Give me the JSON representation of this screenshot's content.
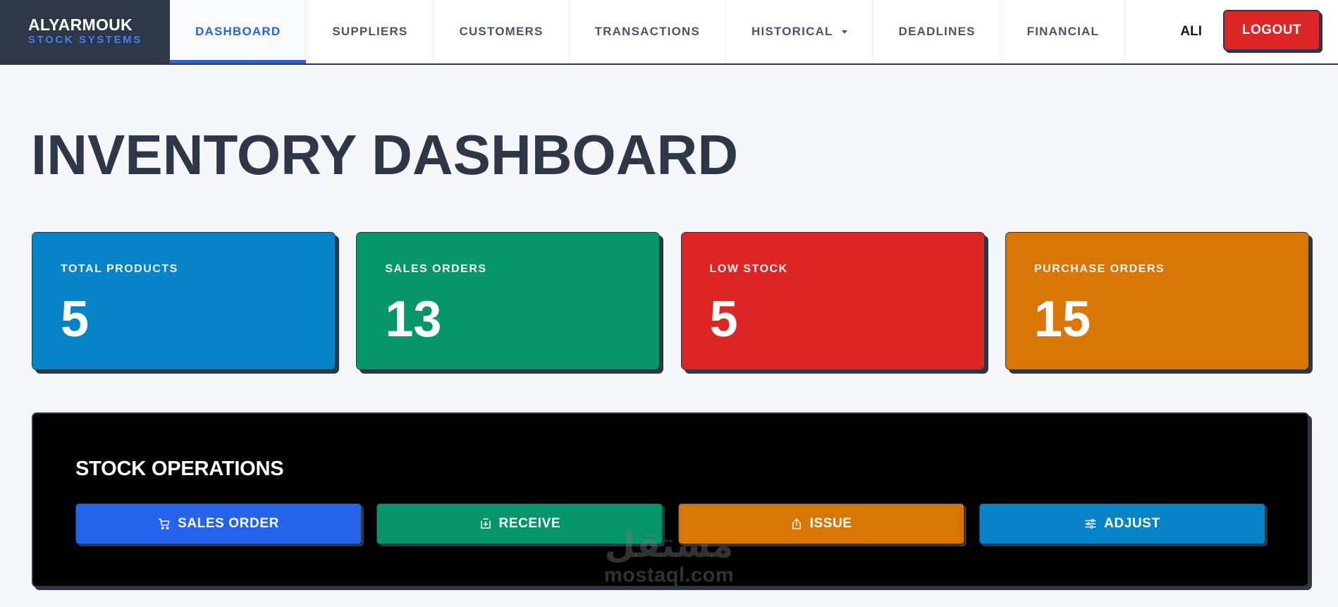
{
  "brand": {
    "name": "ALYARMOUK",
    "subtitle": "STOCK SYSTEMS"
  },
  "nav": {
    "items": [
      {
        "label": "DASHBOARD",
        "active": true
      },
      {
        "label": "SUPPLIERS"
      },
      {
        "label": "CUSTOMERS"
      },
      {
        "label": "TRANSACTIONS"
      },
      {
        "label": "HISTORICAL",
        "has_dropdown": true
      },
      {
        "label": "DEADLINES"
      },
      {
        "label": "FINANCIAL"
      }
    ]
  },
  "user": {
    "name": "ALI",
    "logout_label": "LOGOUT"
  },
  "page": {
    "title": "INVENTORY DASHBOARD"
  },
  "stats": [
    {
      "label": "TOTAL PRODUCTS",
      "value": "5",
      "color": "#0784c7"
    },
    {
      "label": "SALES ORDERS",
      "value": "13",
      "color": "#079669"
    },
    {
      "label": "LOW STOCK",
      "value": "5",
      "color": "#dc2626"
    },
    {
      "label": "PURCHASE ORDERS",
      "value": "15",
      "color": "#d97706"
    }
  ],
  "operations": {
    "title": "STOCK OPERATIONS",
    "buttons": [
      {
        "label": "SALES ORDER",
        "icon": "cart-icon",
        "color": "#2563eb"
      },
      {
        "label": "RECEIVE",
        "icon": "inbox-download-icon",
        "color": "#079669"
      },
      {
        "label": "ISSUE",
        "icon": "share-upload-icon",
        "color": "#d97706"
      },
      {
        "label": "ADJUST",
        "icon": "sliders-icon",
        "color": "#0784c7"
      }
    ]
  },
  "watermark": {
    "arabic": "مستقل",
    "latin": "mostaql.com"
  },
  "colors": {
    "dark": "#2d3748",
    "accent": "#2563eb",
    "danger": "#dc2626",
    "background": "#f6f7f9"
  }
}
